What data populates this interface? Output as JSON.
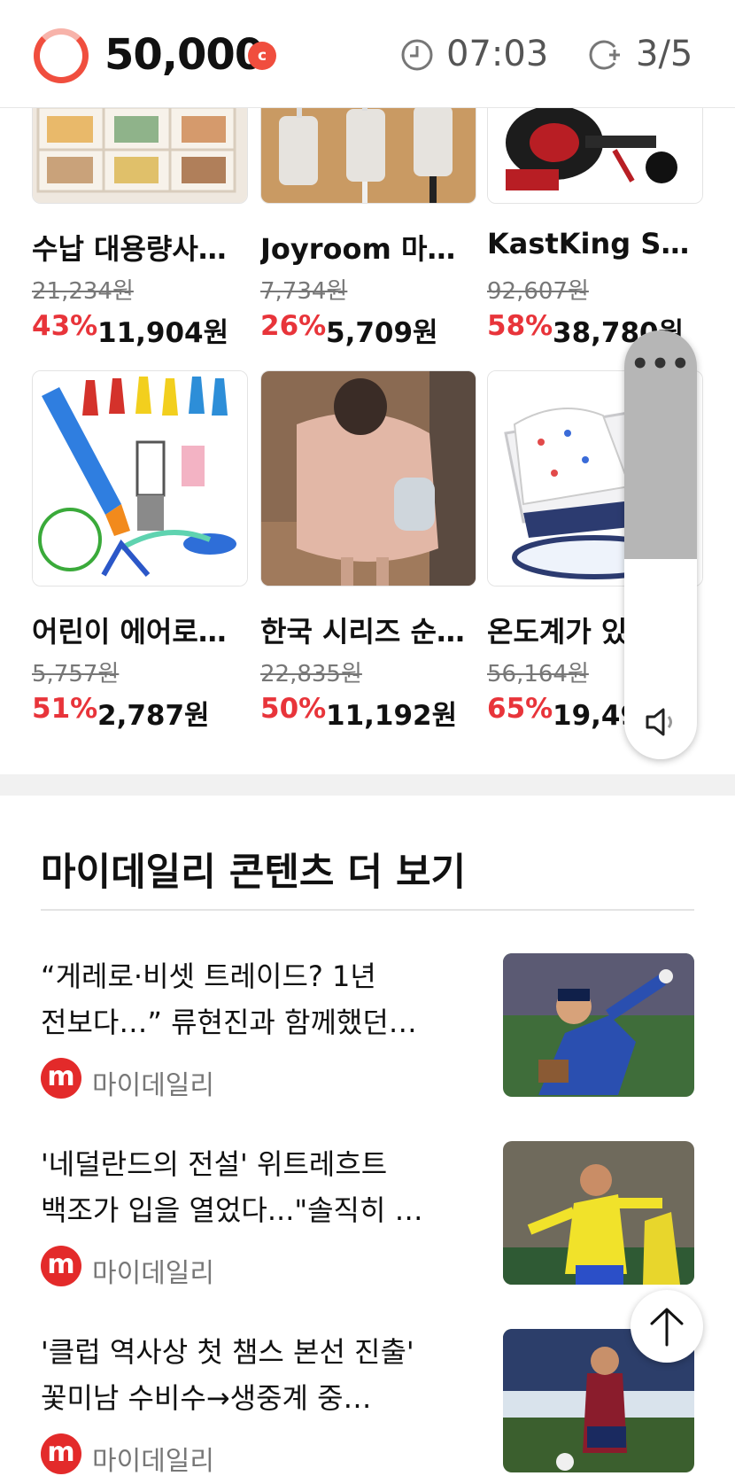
{
  "header": {
    "points": "50,000",
    "coin_symbol": "c",
    "timer": "07:03",
    "count": "3/5",
    "accent_color": "#f04e3e"
  },
  "products": [
    {
      "name": "수납 대용량사…",
      "original_price": "21,234원",
      "discount": "43%",
      "price": "11,904원",
      "image": "storage-shelf"
    },
    {
      "name": "Joyroom 마…",
      "original_price": "7,734원",
      "discount": "26%",
      "price": "5,709원",
      "image": "cable-clips"
    },
    {
      "name": "KastKing Sh…",
      "original_price": "92,607원",
      "discount": "58%",
      "price": "38,780원",
      "image": "fishing-reel"
    },
    {
      "name": "어린이 에어로…",
      "original_price": "5,757원",
      "discount": "51%",
      "price": "2,787원",
      "image": "rocket-launcher-toy"
    },
    {
      "name": "한국 시리즈 순…",
      "original_price": "22,835원",
      "discount": "50%",
      "price": "11,192원",
      "image": "pink-sweater"
    },
    {
      "name": "온도계가 있는…",
      "original_price": "56,164원",
      "discount": "65%",
      "price": "19,490원",
      "image": "baby-bathtub"
    }
  ],
  "side_widget": {
    "menu_icon": "more-dots-icon",
    "speaker_icon": "speaker-icon"
  },
  "more_section": {
    "title": "마이데일리 콘텐츠 더 보기",
    "articles": [
      {
        "line1": "“게레로·비셋 트레이드? 1년",
        "line2": "전보다…” 류현진과 함께했던…",
        "source": "마이데일리",
        "logo": "m",
        "image": "baseball-pitcher"
      },
      {
        "line1": "'네덜란드의 전설' 위트레흐트",
        "line2": "백조가 입을 열었다...\"솔직히 …",
        "source": "마이데일리",
        "logo": "m",
        "image": "soccer-player-yellow"
      },
      {
        "line1": "'클럽 역사상 첫 챔스 본선 진출'",
        "line2": "꽃미남 수비수→생중계 중…",
        "source": "마이데일리",
        "logo": "m",
        "image": "soccer-player-red"
      }
    ]
  },
  "scroll_top_icon": "arrow-up-icon"
}
